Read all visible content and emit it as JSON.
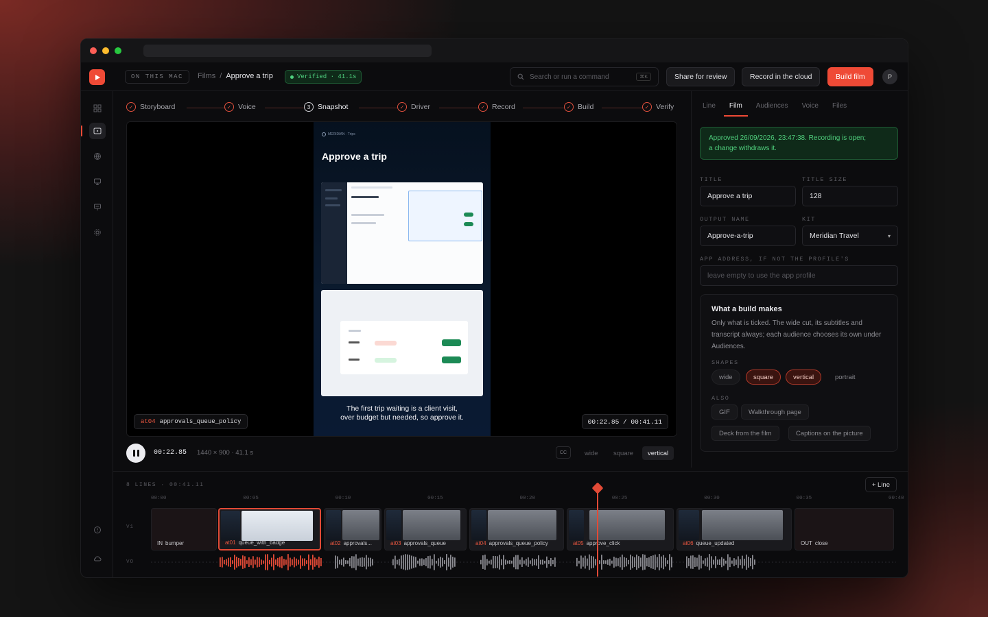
{
  "topbar": {
    "scope": "ON THIS MAC",
    "breadcrumb_root": "Films",
    "breadcrumb_sep": "/",
    "breadcrumb_current": "Approve a trip",
    "verified": "Verified · 41.1s",
    "search_placeholder": "Search or run a command",
    "search_kbd": "⌘K",
    "share": "Share for review",
    "record_cloud": "Record in the cloud",
    "build": "Build film",
    "avatar": "P"
  },
  "steps": [
    "Storyboard",
    "Voice",
    "Snapshot",
    "Driver",
    "Record",
    "Build",
    "Verify"
  ],
  "current_step_number": "3",
  "preview": {
    "brand": "MERIDIAN · Trips",
    "heading": "Approve a trip",
    "caption_line1": "The first trip waiting is a client visit,",
    "caption_line2": "over budget but needed, so approve it.",
    "clip_id": "at04",
    "clip_name": "approvals_queue_policy",
    "timecode": "00:22.85 / 00:41.11"
  },
  "controls": {
    "time": "00:22.85",
    "meta": "1440 × 900 · 41.1 s",
    "cc": "CC",
    "shapes": [
      "wide",
      "square",
      "vertical"
    ],
    "active_shape": "vertical"
  },
  "panel": {
    "tabs": [
      "Line",
      "Film",
      "Audiences",
      "Voice",
      "Files"
    ],
    "active_tab": "Film",
    "approved_line1": "Approved 26/09/2026, 23:47:38. Recording is open;",
    "approved_line2": "a change withdraws it.",
    "title_label": "TITLE",
    "title_value": "Approve a trip",
    "title_size_label": "TITLE SIZE",
    "title_size_value": "128",
    "output_label": "OUTPUT NAME",
    "output_value": "Approve-a-trip",
    "kit_label": "KIT",
    "kit_value": "Meridian Travel",
    "app_label": "APP ADDRESS, IF NOT THE PROFILE'S",
    "app_placeholder": "leave empty to use the app profile",
    "build_heading": "What a build makes",
    "build_text": "Only what is ticked. The wide cut, its subtitles and transcript always; each audience chooses its own under Audiences.",
    "shapes_label": "SHAPES",
    "shape_tags": [
      "wide",
      "square",
      "vertical",
      "portrait"
    ],
    "also_label": "ALSO",
    "also_tags": [
      "GIF",
      "Walkthrough page",
      "Deck from the film",
      "Captions on the picture"
    ]
  },
  "timeline": {
    "header": "8 LINES · 00:41.11",
    "add_line": "+ Line",
    "ticks": [
      "00:00",
      "00:05",
      "00:10",
      "00:15",
      "00:20",
      "00:25",
      "00:30",
      "00:35",
      "00:40"
    ],
    "track_v1": "V1",
    "track_vo": "VO",
    "clips": [
      {
        "id": "IN",
        "name": "bumper"
      },
      {
        "id": "at01",
        "name": "queue_with_badge"
      },
      {
        "id": "at02",
        "name": "approvals..."
      },
      {
        "id": "at03",
        "name": "approvals_queue"
      },
      {
        "id": "at04",
        "name": "approvals_queue_policy"
      },
      {
        "id": "at05",
        "name": "approve_click"
      },
      {
        "id": "at06",
        "name": "queue_updated"
      },
      {
        "id": "OUT",
        "name": "close"
      }
    ],
    "playhead_seconds": 22.85
  },
  "colors": {
    "accent": "#ef4a36",
    "success": "#4fd07f",
    "bg": "#0c0c0e"
  }
}
